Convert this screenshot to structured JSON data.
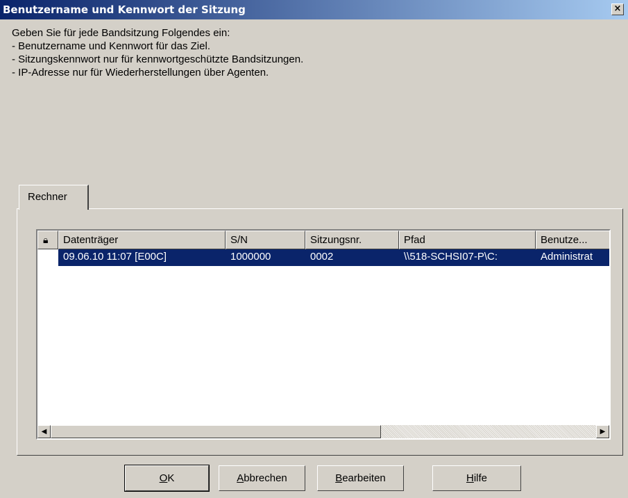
{
  "window": {
    "title": "Benutzername und Kennwort der Sitzung",
    "close_label": "×"
  },
  "instructions": [
    "Geben Sie für jede Bandsitzung Folgendes ein:",
    "- Benutzername und Kennwort für das Ziel.",
    "- Sitzungskennwort nur für kennwortgeschützte Bandsitzungen.",
    "- IP-Adresse nur für Wiederherstellungen über Agenten."
  ],
  "tab": {
    "label": "Rechner"
  },
  "table": {
    "lock_icon": "lock-icon",
    "columns": [
      "Datenträger",
      "S/N",
      "Sitzungsnr.",
      "Pfad",
      "Benutze..."
    ],
    "rows": [
      [
        "09.06.10 11:07 [E00C]",
        "1000000",
        "0002",
        "\\\\518-SCHSI07-P\\C:",
        "Administrat"
      ]
    ],
    "selected_row": 0
  },
  "buttons": {
    "ok": {
      "mnemonic": "O",
      "rest": "K"
    },
    "cancel": {
      "mnemonic": "A",
      "rest": "bbrechen"
    },
    "edit": {
      "mnemonic": "B",
      "rest": "earbeiten"
    },
    "help": {
      "mnemonic": "H",
      "rest": "ilfe"
    }
  },
  "colors": {
    "selection": "#0a246a",
    "title_gradient_start": "#0a246a",
    "title_gradient_end": "#a6caf0",
    "face": "#d4d0c8"
  }
}
